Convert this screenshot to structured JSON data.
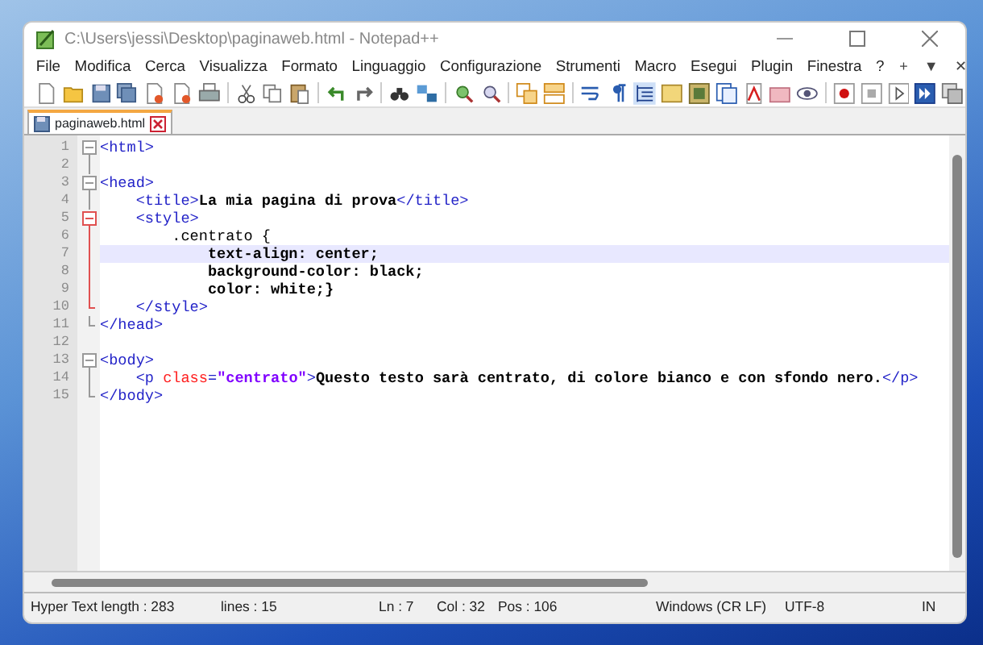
{
  "window": {
    "title": "C:\\Users\\jessi\\Desktop\\paginaweb.html - Notepad++"
  },
  "menu": {
    "items": [
      "File",
      "Modifica",
      "Cerca",
      "Visualizza",
      "Formato",
      "Linguaggio",
      "Configurazione",
      "Strumenti",
      "Macro",
      "Esegui",
      "Plugin",
      "Finestra",
      "?"
    ],
    "right_controls": [
      "+",
      "▼",
      "✕"
    ]
  },
  "tabs": [
    {
      "label": "paginaweb.html",
      "selected": true
    }
  ],
  "editor": {
    "lines": [
      {
        "number": "1",
        "fold": {
          "kind": "start",
          "highlighted": false
        },
        "current": false,
        "segments": [
          {
            "kind": "tag",
            "text": "<html>"
          }
        ]
      },
      {
        "number": "2",
        "fold": {
          "kind": "line",
          "highlighted": false
        },
        "current": false
      },
      {
        "number": "3",
        "fold": {
          "kind": "start",
          "highlighted": false
        },
        "current": false,
        "segments": [
          {
            "kind": "tag",
            "text": "<head>"
          }
        ]
      },
      {
        "number": "4",
        "fold": {
          "kind": "line",
          "highlighted": false
        },
        "current": false,
        "segments": [
          {
            "kind": "tag",
            "text": "    <title>"
          },
          {
            "kind": "text",
            "text": "La mia pagina di prova"
          },
          {
            "kind": "tag",
            "text": "</title>"
          }
        ]
      },
      {
        "number": "5",
        "fold": {
          "kind": "start",
          "highlighted": true
        },
        "current": false,
        "segments": [
          {
            "kind": "tag",
            "text": "    <style>"
          }
        ]
      },
      {
        "number": "6",
        "fold": {
          "kind": "line",
          "highlighted": true
        },
        "current": false,
        "segments": [
          {
            "kind": "plain",
            "text": "        .centrato {"
          }
        ]
      },
      {
        "number": "7",
        "fold": {
          "kind": "line",
          "highlighted": true
        },
        "current": true,
        "segments": [
          {
            "kind": "text",
            "text": "            text-align: center;"
          }
        ]
      },
      {
        "number": "8",
        "fold": {
          "kind": "line",
          "highlighted": true
        },
        "current": false,
        "segments": [
          {
            "kind": "text",
            "text": "            background-color: black;"
          }
        ]
      },
      {
        "number": "9",
        "fold": {
          "kind": "line",
          "highlighted": true
        },
        "current": false,
        "segments": [
          {
            "kind": "text",
            "text": "            color: white;}"
          }
        ]
      },
      {
        "number": "10",
        "fold": {
          "kind": "end",
          "highlighted": true
        },
        "current": false,
        "segments": [
          {
            "kind": "tag",
            "text": "    </style>"
          }
        ]
      },
      {
        "number": "11",
        "fold": {
          "kind": "end",
          "highlighted": false
        },
        "current": false,
        "segments": [
          {
            "kind": "tag",
            "text": "</head>"
          }
        ]
      },
      {
        "number": "12",
        "current": false
      },
      {
        "number": "13",
        "fold": {
          "kind": "start",
          "highlighted": false
        },
        "current": false,
        "segments": [
          {
            "kind": "tag",
            "text": "<body>"
          }
        ]
      },
      {
        "number": "14",
        "fold": {
          "kind": "line",
          "highlighted": false
        },
        "current": false,
        "segments": [
          {
            "kind": "tag",
            "text": "    <p "
          },
          {
            "kind": "attr",
            "text": "class"
          },
          {
            "kind": "tag",
            "text": "="
          },
          {
            "kind": "string",
            "text": "\"centrato\""
          },
          {
            "kind": "tag",
            "text": ">"
          },
          {
            "kind": "text",
            "text": "Questo testo sarà centrato, di colore bianco e con sfondo nero."
          },
          {
            "kind": "tag",
            "text": "</p>"
          }
        ]
      },
      {
        "number": "15",
        "fold": {
          "kind": "end",
          "highlighted": false
        },
        "current": false,
        "segments": [
          {
            "kind": "tag",
            "text": "</body>"
          }
        ]
      }
    ]
  },
  "status_bar": {
    "length": "Hyper Text length : 283",
    "lines": "lines : 15",
    "ln": "Ln : 7",
    "col": "Col : 32",
    "pos": "Pos : 106",
    "eol": "Windows (CR LF)",
    "encoding": "UTF-8",
    "mode": "IN"
  }
}
